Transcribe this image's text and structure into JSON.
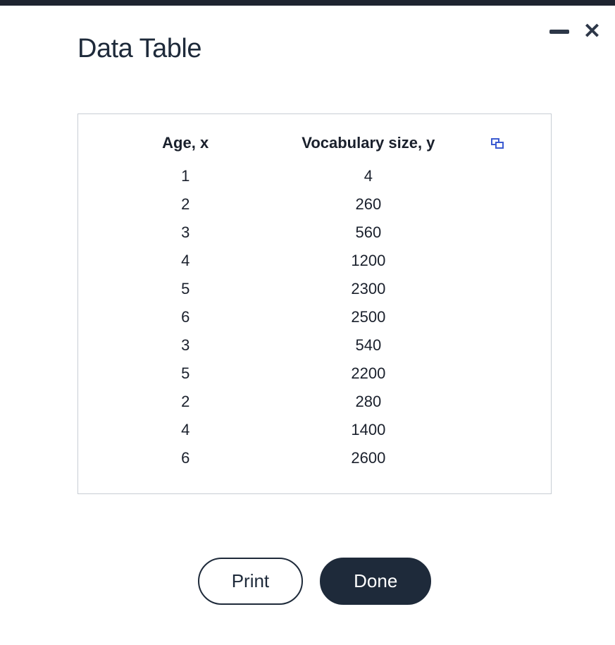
{
  "title": "Data Table",
  "table": {
    "headers": {
      "x": "Age, x",
      "y": "Vocabulary size, y"
    },
    "rows": [
      {
        "x": "1",
        "y": "4"
      },
      {
        "x": "2",
        "y": "260"
      },
      {
        "x": "3",
        "y": "560"
      },
      {
        "x": "4",
        "y": "1200"
      },
      {
        "x": "5",
        "y": "2300"
      },
      {
        "x": "6",
        "y": "2500"
      },
      {
        "x": "3",
        "y": "540"
      },
      {
        "x": "5",
        "y": "2200"
      },
      {
        "x": "2",
        "y": "280"
      },
      {
        "x": "4",
        "y": "1400"
      },
      {
        "x": "6",
        "y": "2600"
      }
    ]
  },
  "buttons": {
    "print": "Print",
    "done": "Done"
  }
}
